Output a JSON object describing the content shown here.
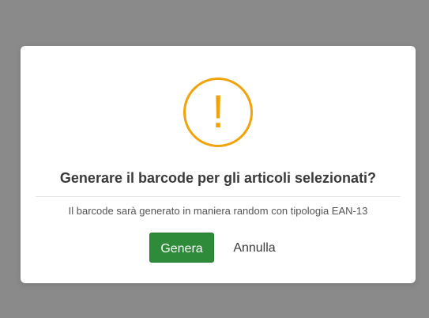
{
  "dialog": {
    "icon": "warning-exclamation-icon",
    "icon_glyph": "!",
    "icon_color": "#f0a30a",
    "title": "Generare il barcode per gli articoli selezionati?",
    "message": "Il barcode sarà generato in maniera random con tipologia EAN-13",
    "confirm_label": "Genera",
    "confirm_color": "#2e8b3a",
    "cancel_label": "Annulla"
  }
}
